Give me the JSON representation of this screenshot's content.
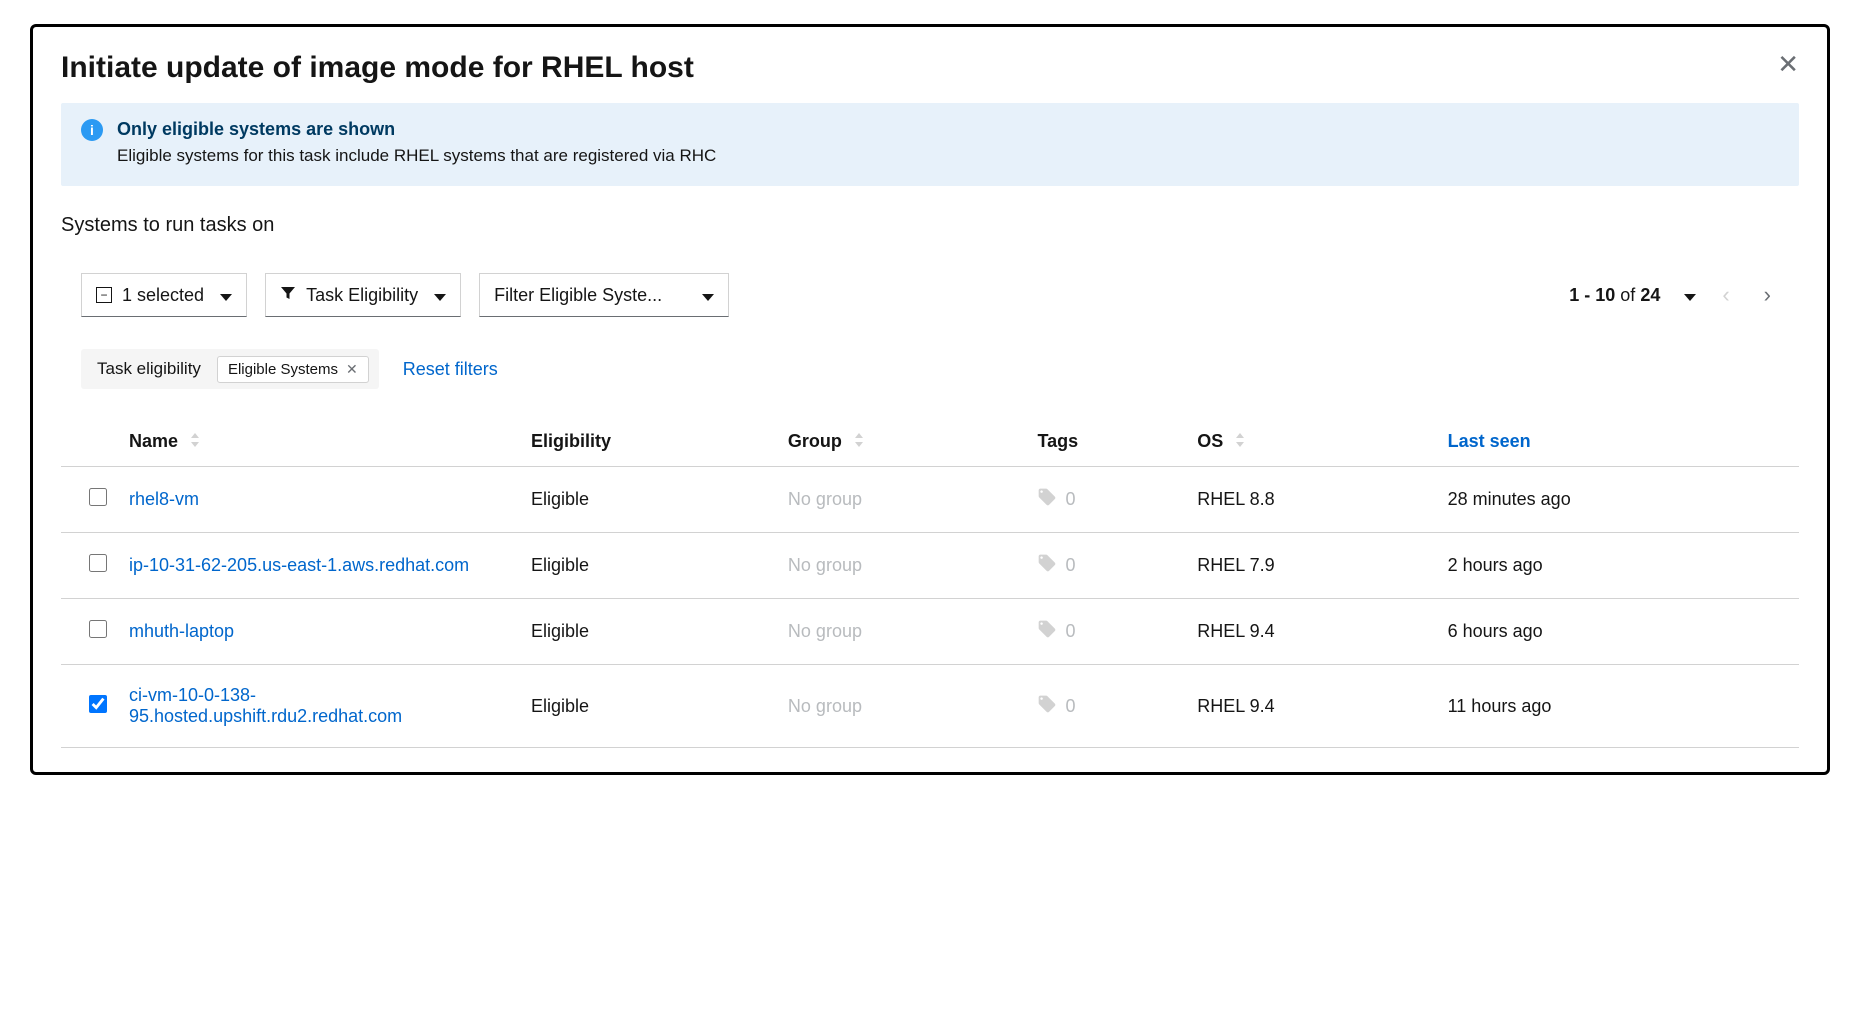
{
  "modal": {
    "title": "Initiate update of image mode for RHEL host"
  },
  "alert": {
    "title": "Only eligible systems are shown",
    "description": "Eligible systems for this task include RHEL systems that are registered via RHC"
  },
  "section_title": "Systems to run tasks on",
  "toolbar": {
    "selected_label": "1 selected",
    "filter_category": "Task Eligibility",
    "filter_value": "Filter Eligible Syste..."
  },
  "pagination": {
    "range": "1 - 10",
    "of_label": "of",
    "total": "24"
  },
  "chips": {
    "group_label": "Task eligibility",
    "chip_label": "Eligible Systems",
    "reset_label": "Reset filters"
  },
  "columns": {
    "name": "Name",
    "eligibility": "Eligibility",
    "group": "Group",
    "tags": "Tags",
    "os": "OS",
    "last_seen": "Last seen"
  },
  "rows": [
    {
      "checked": false,
      "name": "rhel8-vm",
      "eligibility": "Eligible",
      "group": "No group",
      "tags": "0",
      "os": "RHEL 8.8",
      "last_seen": "28 minutes ago"
    },
    {
      "checked": false,
      "name": "ip-10-31-62-205.us-east-1.aws.redhat.com",
      "eligibility": "Eligible",
      "group": "No group",
      "tags": "0",
      "os": "RHEL 7.9",
      "last_seen": "2 hours ago"
    },
    {
      "checked": false,
      "name": "mhuth-laptop",
      "eligibility": "Eligible",
      "group": "No group",
      "tags": "0",
      "os": "RHEL 9.4",
      "last_seen": "6 hours ago"
    },
    {
      "checked": true,
      "name": "ci-vm-10-0-138-95.hosted.upshift.rdu2.redhat.com",
      "eligibility": "Eligible",
      "group": "No group",
      "tags": "0",
      "os": "RHEL 9.4",
      "last_seen": "11 hours ago"
    }
  ]
}
